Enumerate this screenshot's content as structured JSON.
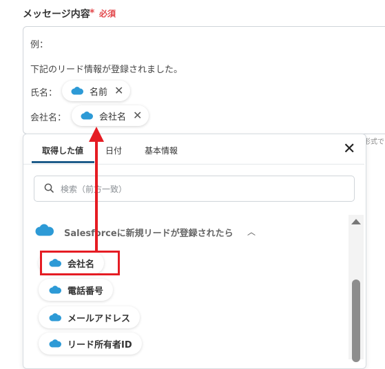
{
  "field": {
    "label": "メッセージ内容",
    "required_star": "*",
    "required_text": "必須"
  },
  "message": {
    "line1": "例：",
    "line2": "下記のリード情報が登録されました。",
    "name_label": "氏名：",
    "company_label": "会社名：",
    "chip_name": "名前",
    "chip_company": "会社名",
    "close_glyph": "✕"
  },
  "hint_text": "形式で",
  "panel": {
    "tabs": [
      "取得した値",
      "日付",
      "基本情報"
    ],
    "active_tab": "取得した値",
    "close_glyph": "✕",
    "search_placeholder": "検索（前方一致）",
    "group_title": "Salesforceに新規リードが登録されたら",
    "group_caret": "︿",
    "items": [
      "会社名",
      "電話番号",
      "メールアドレス",
      "リード所有者ID"
    ]
  },
  "colors": {
    "salesforce": "#2d9ad6",
    "annotation": "#e51c23",
    "required": "#e2474b",
    "tab_underline": "#1f5d8a"
  }
}
